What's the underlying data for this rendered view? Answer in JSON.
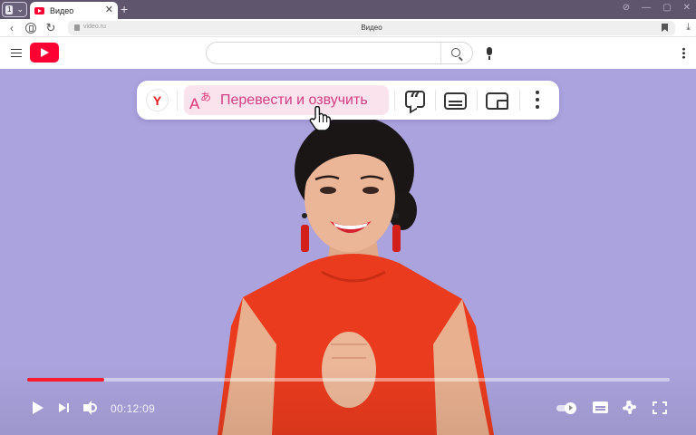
{
  "browser": {
    "tab_count": "1",
    "active_tab_title": "Видео",
    "url_domain": "video.ru",
    "page_title": "Видео"
  },
  "toolbar": {
    "brand_letter": "Y",
    "translate_label": "Перевести и озвучить",
    "translate_icon_latin": "A",
    "translate_icon_kana": "あ"
  },
  "player": {
    "current_time": "00:12:09",
    "progress_fraction": 0.12,
    "progress_color": "#ff1a2e"
  },
  "colors": {
    "background": "#aaa3dd",
    "accent": "#d23c82",
    "accent_bg": "#fbe3ee",
    "logo": "#ff0033"
  },
  "icons": {
    "header": [
      "menu-icon",
      "logo-icon",
      "search-icon",
      "mic-icon",
      "kebab-icon"
    ],
    "toolbar": [
      "yandex-icon",
      "translate-icon",
      "quote-icon",
      "subtitles-icon",
      "pip-icon",
      "more-icon"
    ],
    "player": [
      "play-icon",
      "next-icon",
      "volume-icon",
      "autoplay-icon",
      "cc-icon",
      "settings-icon",
      "fullscreen-icon"
    ]
  }
}
